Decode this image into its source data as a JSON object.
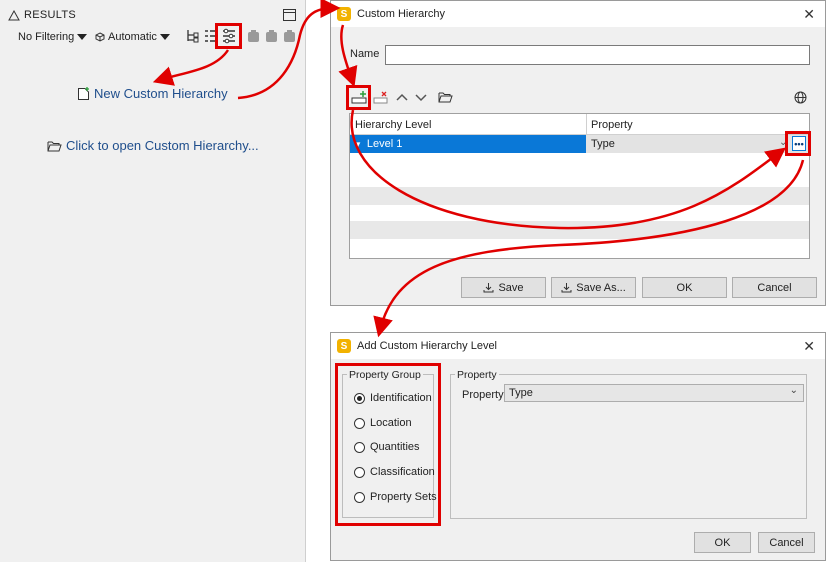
{
  "results": {
    "title": "RESULTS",
    "filter_label": "No Filtering",
    "mode_label": "Automatic",
    "new_hierarchy_link": "New Custom Hierarchy",
    "open_hierarchy_link": "Click to open Custom Hierarchy..."
  },
  "custom_hierarchy_dialog": {
    "title": "Custom Hierarchy",
    "app_icon_letter": "S",
    "name_label": "Name",
    "name_value": "",
    "columns": [
      "Hierarchy Level",
      "Property"
    ],
    "rows": [
      {
        "level": "Level 1",
        "property": "Type"
      }
    ],
    "buttons": {
      "save": "Save",
      "save_as": "Save As...",
      "ok": "OK",
      "cancel": "Cancel"
    }
  },
  "add_level_dialog": {
    "title": "Add Custom Hierarchy Level",
    "app_icon_letter": "S",
    "property_group_label": "Property Group",
    "groups": [
      "Identification",
      "Location",
      "Quantities",
      "Classification",
      "Property Sets"
    ],
    "selected_group": "Identification",
    "property_section_label": "Property",
    "property_label": "Property",
    "property_value": "Type",
    "buttons": {
      "ok": "OK",
      "cancel": "Cancel"
    }
  },
  "colors": {
    "highlight": "#e00000",
    "link": "#1f4e8c",
    "selection": "#0a78d7"
  },
  "icons": [
    "warning-icon",
    "maximize-icon",
    "hierarchy-icon",
    "list-icon",
    "custom-hierarchy-icon",
    "clipboard-icon",
    "new-document-icon",
    "folder-open-icon",
    "add-level-icon",
    "remove-level-icon",
    "arrow-up-icon",
    "arrow-down-icon",
    "browse-ellipsis-icon",
    "globe-icon",
    "download-icon",
    "close-icon"
  ]
}
